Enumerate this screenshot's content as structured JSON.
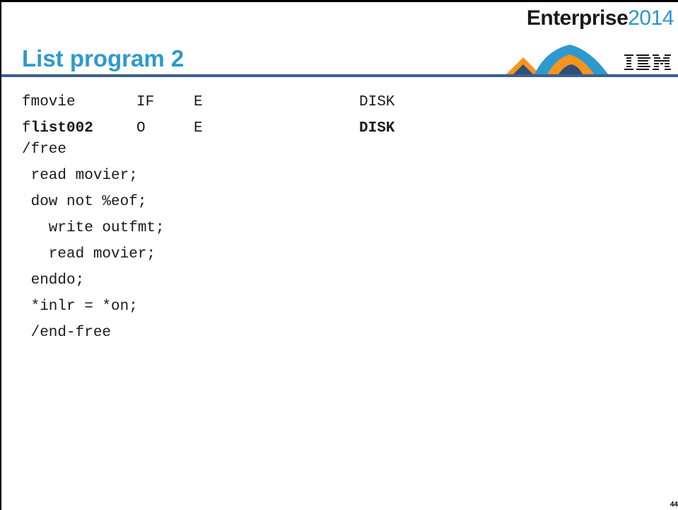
{
  "header": {
    "brand_word": "Enterprise",
    "brand_year": "2014",
    "corporate_logo": "IBM"
  },
  "slide": {
    "title": "List program 2",
    "page_number": "44"
  },
  "code": {
    "line1": {
      "prefix": "fmovie",
      "type": "IF",
      "format": "E",
      "device": "DISK"
    },
    "line2": {
      "prefix": "f",
      "name": "list002",
      "type": "O",
      "format": "E",
      "device": "DISK"
    },
    "line3": "/free",
    "line4": " read movier;",
    "line5": " dow not %eof;",
    "line6": "   write outfmt;",
    "line7": "   read movier;",
    "line8": " enddo;",
    "line9": " *inlr = *on;",
    "line10": " /end-free"
  },
  "colors": {
    "title": "#2e99cf",
    "brand_year": "#2b95cf",
    "rule": "#3d5f8f",
    "logo_orange": "#f7941d",
    "logo_teal": "#2e99cf",
    "logo_dark": "#2f4f7a"
  }
}
